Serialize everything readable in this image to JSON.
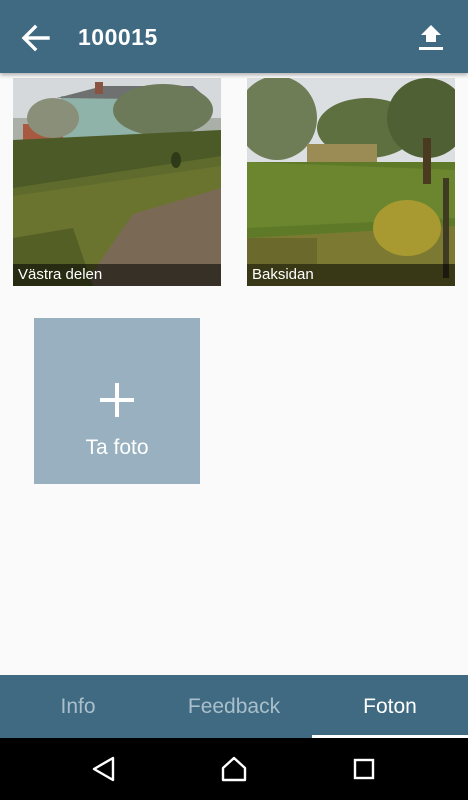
{
  "app_bar": {
    "title": "100015",
    "back_icon": "arrow-back-icon",
    "upload_icon": "upload-icon",
    "color": "#3f6a82"
  },
  "photos": [
    {
      "caption": "Västra delen"
    },
    {
      "caption": "Baksidan"
    }
  ],
  "add_photo": {
    "label": "Ta foto",
    "icon": "plus-icon",
    "color": "#98b0bf"
  },
  "tabs": [
    {
      "label": "Info",
      "active": false
    },
    {
      "label": "Feedback",
      "active": false
    },
    {
      "label": "Foton",
      "active": true
    }
  ],
  "system_nav": {
    "back_icon": "nav-back-icon",
    "home_icon": "nav-home-icon",
    "recents_icon": "nav-recents-icon"
  }
}
